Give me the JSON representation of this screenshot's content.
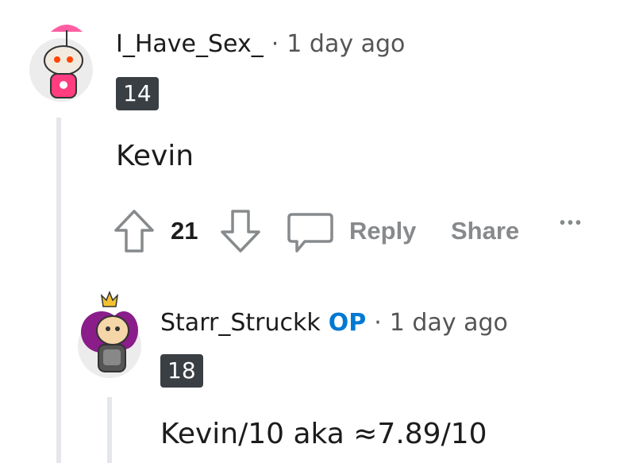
{
  "comments": [
    {
      "username": "I_Have_Sex_",
      "separator": "·",
      "time": "1 day ago",
      "flair": "14",
      "body": "Kevin",
      "upvotes": "21",
      "reply_label": "Reply",
      "share_label": "Share",
      "more_label": "•••"
    },
    {
      "username": "Starr_Struckk",
      "op_badge": "OP",
      "separator": "·",
      "time": "1 day ago",
      "flair": "18",
      "body": "Kevin/10 aka ≈7.89/10"
    }
  ],
  "colors": {
    "op_badge": "#0079d3",
    "flair_bg": "#3a3f44",
    "action_gray": "#878a8c",
    "thread_line": "#e5e7ea"
  },
  "icons": [
    "upvote-icon",
    "downvote-icon",
    "comment-icon",
    "more-icon"
  ]
}
